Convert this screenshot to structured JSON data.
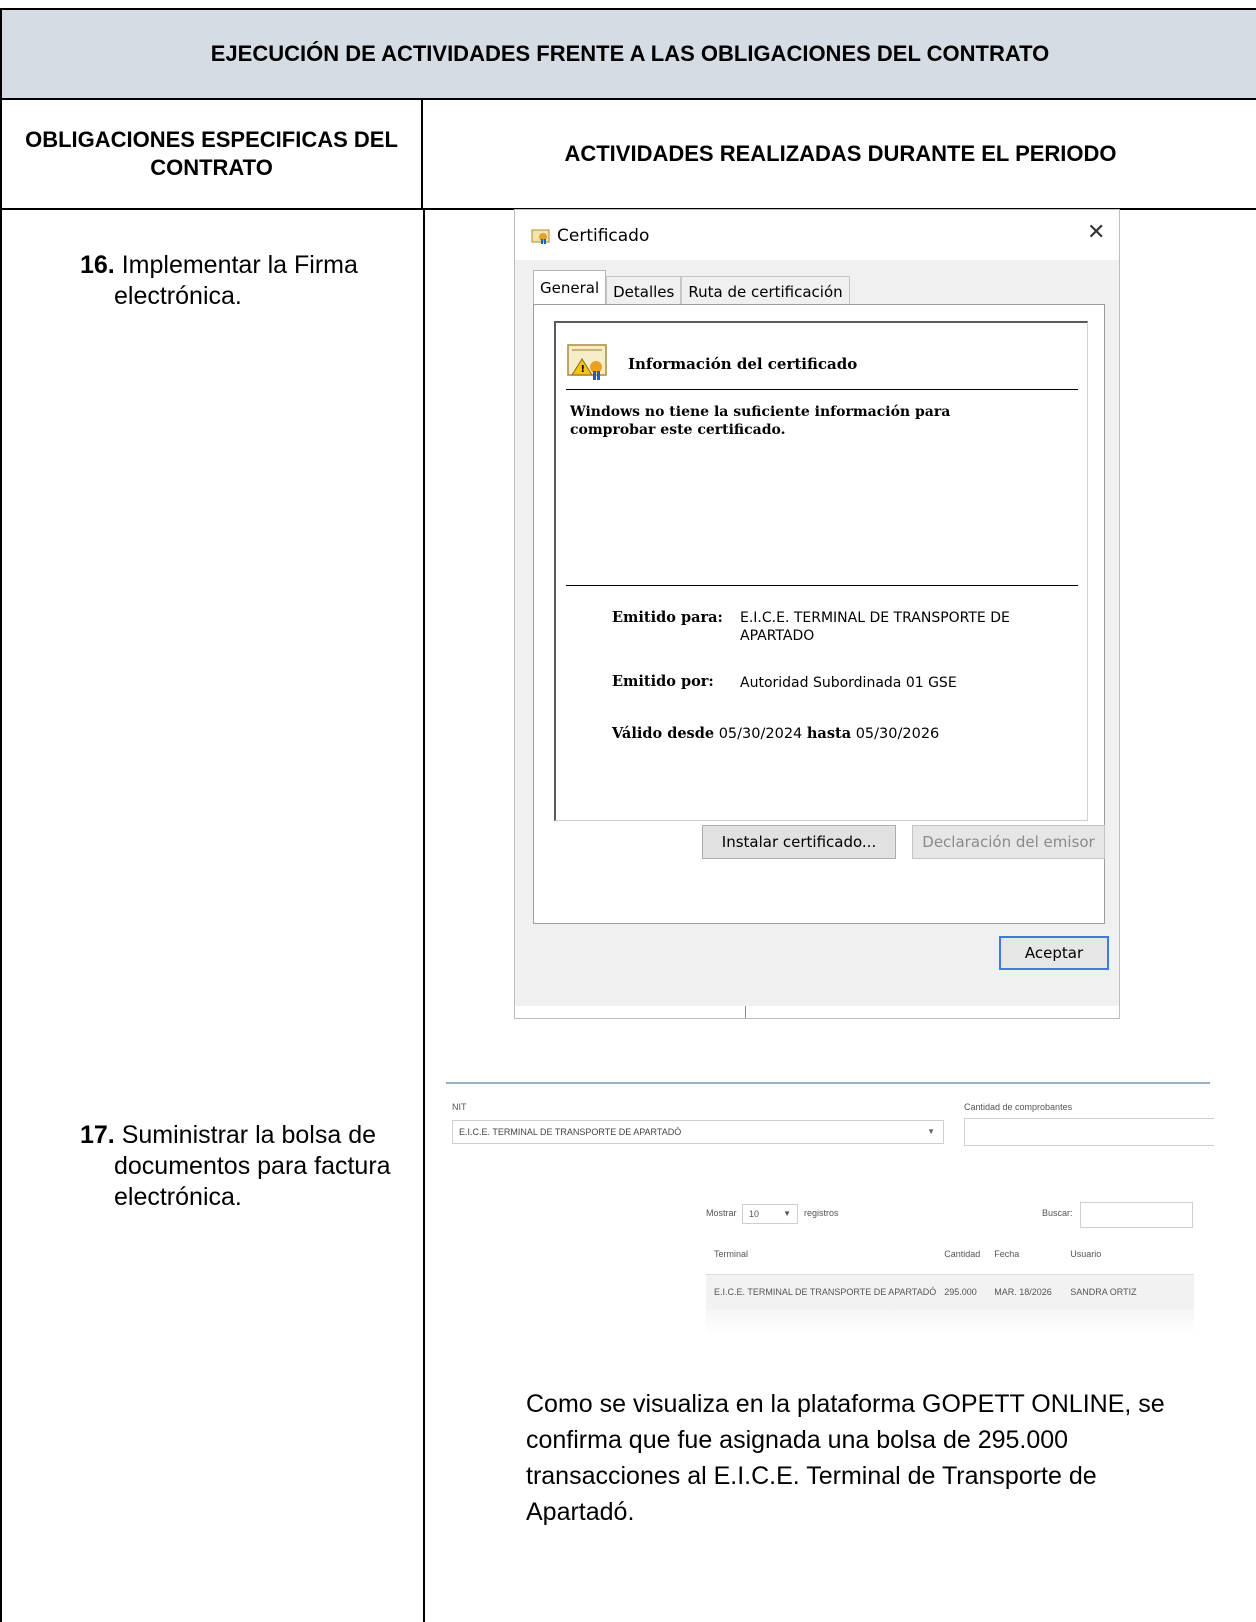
{
  "document": {
    "title": "EJECUCIÓN DE ACTIVIDADES FRENTE A LAS OBLIGACIONES DEL CONTRATO",
    "col_left_header": "OBLIGACIONES ESPECIFICAS DEL CONTRATO",
    "col_right_header": "ACTIVIDADES REALIZADAS DURANTE EL PERIODO"
  },
  "obligations": [
    {
      "number": "16.",
      "text": "Implementar la Firma electrónica."
    },
    {
      "number": "17.",
      "text": "Suministrar la bolsa de documentos para factura electrónica."
    }
  ],
  "certificate_dialog": {
    "window_title": "Certificado",
    "close_icon": "close-icon",
    "close_glyph": "✕",
    "tabs": [
      "General",
      "Detalles",
      "Ruta de certificación"
    ],
    "active_tab": "General",
    "info_heading": "Información del certificado",
    "warning": "Windows no tiene la suficiente información para comprobar este certificado.",
    "issued_to_label": "Emitido para:",
    "issued_to_value": "E.I.C.E. TERMINAL DE TRANSPORTE DE APARTADO",
    "issued_by_label": "Emitido por:",
    "issued_by_value": "Autoridad Subordinada 01 GSE",
    "valid_from_label": "Válido desde",
    "valid_from_value": "05/30/2024",
    "valid_to_label": "hasta",
    "valid_to_value": "05/30/2026",
    "install_button": "Instalar certificado...",
    "issuer_statement_button": "Declaración del emisor",
    "accept_button": "Aceptar",
    "icon_accent": "#e9a21f"
  },
  "gopett": {
    "nit_label": "NIT",
    "nit_value": "E.I.C.E. TERMINAL DE TRANSPORTE DE APARTADÓ",
    "count_label": "Cantidad de comprobantes",
    "show_label": "Mostrar",
    "show_value": "10",
    "records_label": "registros",
    "search_label": "Buscar:",
    "columns": [
      "Terminal",
      "Cantidad",
      "Fecha",
      "Usuario"
    ],
    "rows": [
      [
        "E.I.C.E. TERMINAL DE TRANSPORTE DE APARTADÓ",
        "295.000",
        "MAR. 18/2026",
        "SANDRA ORTIZ"
      ]
    ]
  },
  "paragraph": "Como se visualiza en la plataforma GOPETT ONLINE, se confirma que fue asignada una bolsa de 295.000 transacciones al E.I.C.E. Terminal de Transporte de Apartadó.",
  "colors": {
    "title_background": "#d5dce4",
    "accent_blue": "#3d7be0"
  }
}
